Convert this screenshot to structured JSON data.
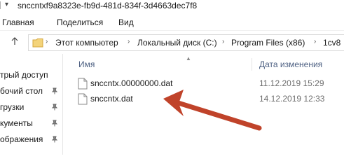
{
  "window": {
    "title": "snccntxf9a8323e-fb9d-481d-834f-3d4663dec7f8"
  },
  "ribbon": {
    "tabs": [
      "Главная",
      "Поделиться",
      "Вид"
    ]
  },
  "address": {
    "segments": [
      "Этот компьютер",
      "Локальный диск (C:)",
      "Program Files (x86)",
      "1cv8"
    ]
  },
  "nav": {
    "items": [
      {
        "label": "трый доступ",
        "pinned": false
      },
      {
        "label": "бочий стол",
        "pinned": true
      },
      {
        "label": "грузки",
        "pinned": true
      },
      {
        "label": "кументы",
        "pinned": true
      },
      {
        "label": "ображения",
        "pinned": true
      }
    ]
  },
  "columns": {
    "name": "Имя",
    "date": "Дата изменения"
  },
  "files": [
    {
      "name": "snccntx.00000000.dat",
      "date": "11.12.2019 15:29"
    },
    {
      "name": "snccntx.dat",
      "date": "14.12.2019 12:33"
    }
  ],
  "colors": {
    "annotation_arrow": "#c0432a",
    "folder": "#e8c36a",
    "header_text": "#4d6082"
  },
  "icons": [
    "chevron-down-icon",
    "up-arrow-icon",
    "folder-icon",
    "chevron-right-icon",
    "pin-icon",
    "file-icon",
    "sort-up-icon"
  ]
}
